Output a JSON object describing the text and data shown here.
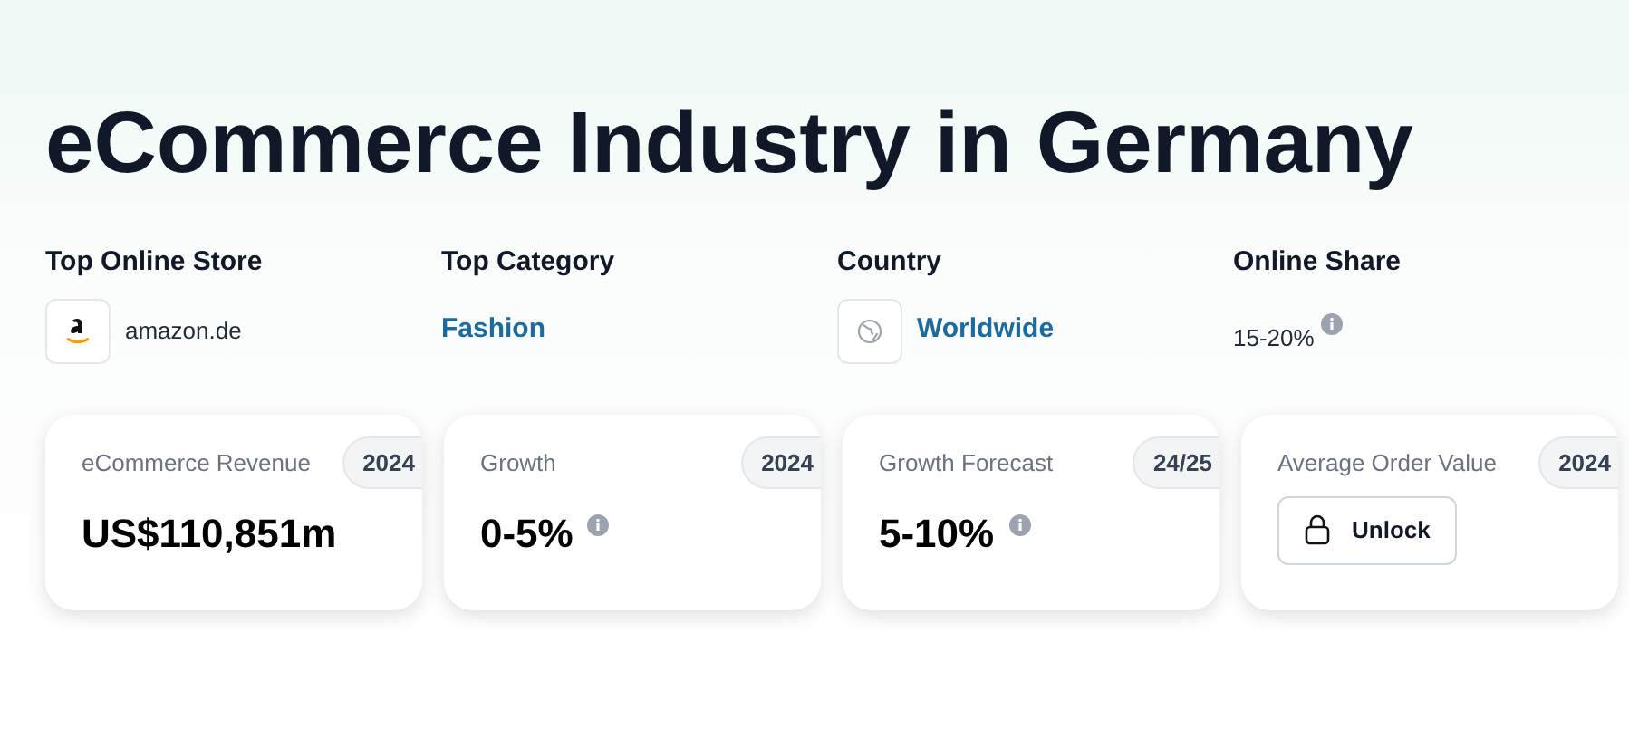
{
  "title": "eCommerce Industry in Germany",
  "facts": [
    {
      "label": "Top Online Store",
      "kind": "store",
      "value": "amazon.de"
    },
    {
      "label": "Top Category",
      "kind": "link",
      "value": "Fashion"
    },
    {
      "label": "Country",
      "kind": "country",
      "value": "Worldwide"
    },
    {
      "label": "Online Share",
      "kind": "share",
      "value": "15-20%"
    }
  ],
  "cards": [
    {
      "label": "eCommerce Revenue",
      "badge": "2024",
      "kind": "value",
      "value": "US$110,851m",
      "info": false
    },
    {
      "label": "Growth",
      "badge": "2024",
      "kind": "value",
      "value": "0-5%",
      "info": true
    },
    {
      "label": "Growth Forecast",
      "badge": "24/25",
      "kind": "value",
      "value": "5-10%",
      "info": true
    },
    {
      "label": "Average Order Value",
      "badge": "2024",
      "kind": "locked",
      "value": "Unlock"
    }
  ]
}
